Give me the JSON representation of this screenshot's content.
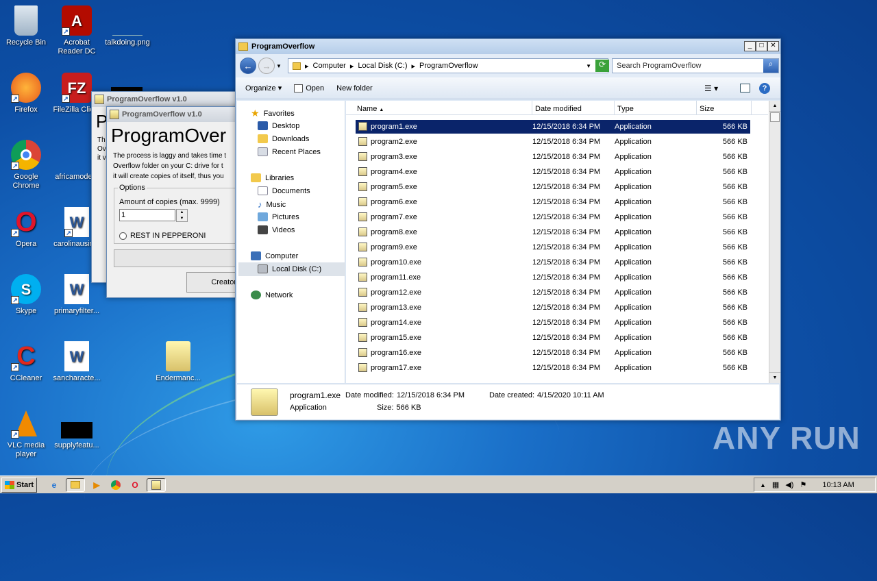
{
  "desktop": {
    "icons": [
      {
        "label": "Recycle Bin",
        "icon": "recycle-bin-icon"
      },
      {
        "label": "Acrobat Reader DC",
        "icon": "acrobat-icon"
      },
      {
        "label": "talkdoing.png",
        "icon": "image-file-icon"
      },
      {
        "label": "Firefox",
        "icon": "firefox-icon"
      },
      {
        "label": "FileZilla Clie...",
        "icon": "filezilla-icon"
      },
      {
        "label": "Google Chrome",
        "icon": "chrome-icon"
      },
      {
        "label": "africamode...",
        "icon": "file-icon"
      },
      {
        "label": "Opera",
        "icon": "opera-icon"
      },
      {
        "label": "carolinausin...",
        "icon": "word-doc-icon"
      },
      {
        "label": "Skype",
        "icon": "skype-icon"
      },
      {
        "label": "primaryfilter...",
        "icon": "word-doc-icon"
      },
      {
        "label": "CCleaner",
        "icon": "ccleaner-icon"
      },
      {
        "label": "sancharacte...",
        "icon": "word-doc-icon"
      },
      {
        "label": "Endermanc...",
        "icon": "program-icon"
      },
      {
        "label": "VLC media player",
        "icon": "vlc-icon"
      },
      {
        "label": "supplyfeatu...",
        "icon": "image-file-icon"
      }
    ]
  },
  "po_window": {
    "title": "ProgramOverflow v1.0",
    "heading": "ProgramOver",
    "description_lines": [
      "The process is laggy and takes time t",
      "Overflow folder on your C: drive for t",
      "it will create copies of itself, thus you"
    ],
    "options_label": "Options",
    "copies_label": "Amount of copies (max. 9999)",
    "copies_value": "1",
    "radio_label": "REST IN PEPPERONI",
    "creator_button": "Creator",
    "back_heading": "P",
    "back_text": [
      "Th",
      "Ov",
      "it v"
    ]
  },
  "explorer": {
    "title": "ProgramOverflow",
    "breadcrumb": [
      "Computer",
      "Local Disk (C:)",
      "ProgramOverflow"
    ],
    "search_placeholder": "Search ProgramOverflow",
    "commands": {
      "organize": "Organize",
      "open": "Open",
      "new_folder": "New folder"
    },
    "nav": {
      "favorites": "Favorites",
      "desktop": "Desktop",
      "downloads": "Downloads",
      "recent": "Recent Places",
      "libraries": "Libraries",
      "documents": "Documents",
      "music": "Music",
      "pictures": "Pictures",
      "videos": "Videos",
      "computer": "Computer",
      "local_disk": "Local Disk (C:)",
      "network": "Network"
    },
    "columns": {
      "name": "Name",
      "date": "Date modified",
      "type": "Type",
      "size": "Size"
    },
    "files": [
      {
        "name": "program1.exe",
        "date": "12/15/2018 6:34 PM",
        "type": "Application",
        "size": "566 KB"
      },
      {
        "name": "program2.exe",
        "date": "12/15/2018 6:34 PM",
        "type": "Application",
        "size": "566 KB"
      },
      {
        "name": "program3.exe",
        "date": "12/15/2018 6:34 PM",
        "type": "Application",
        "size": "566 KB"
      },
      {
        "name": "program4.exe",
        "date": "12/15/2018 6:34 PM",
        "type": "Application",
        "size": "566 KB"
      },
      {
        "name": "program5.exe",
        "date": "12/15/2018 6:34 PM",
        "type": "Application",
        "size": "566 KB"
      },
      {
        "name": "program6.exe",
        "date": "12/15/2018 6:34 PM",
        "type": "Application",
        "size": "566 KB"
      },
      {
        "name": "program7.exe",
        "date": "12/15/2018 6:34 PM",
        "type": "Application",
        "size": "566 KB"
      },
      {
        "name": "program8.exe",
        "date": "12/15/2018 6:34 PM",
        "type": "Application",
        "size": "566 KB"
      },
      {
        "name": "program9.exe",
        "date": "12/15/2018 6:34 PM",
        "type": "Application",
        "size": "566 KB"
      },
      {
        "name": "program10.exe",
        "date": "12/15/2018 6:34 PM",
        "type": "Application",
        "size": "566 KB"
      },
      {
        "name": "program11.exe",
        "date": "12/15/2018 6:34 PM",
        "type": "Application",
        "size": "566 KB"
      },
      {
        "name": "program12.exe",
        "date": "12/15/2018 6:34 PM",
        "type": "Application",
        "size": "566 KB"
      },
      {
        "name": "program13.exe",
        "date": "12/15/2018 6:34 PM",
        "type": "Application",
        "size": "566 KB"
      },
      {
        "name": "program14.exe",
        "date": "12/15/2018 6:34 PM",
        "type": "Application",
        "size": "566 KB"
      },
      {
        "name": "program15.exe",
        "date": "12/15/2018 6:34 PM",
        "type": "Application",
        "size": "566 KB"
      },
      {
        "name": "program16.exe",
        "date": "12/15/2018 6:34 PM",
        "type": "Application",
        "size": "566 KB"
      },
      {
        "name": "program17.exe",
        "date": "12/15/2018 6:34 PM",
        "type": "Application",
        "size": "566 KB"
      }
    ],
    "details": {
      "name": "program1.exe",
      "modified_label": "Date modified:",
      "modified": "12/15/2018 6:34 PM",
      "created_label": "Date created:",
      "created": "4/15/2020 10:11 AM",
      "type": "Application",
      "size_label": "Size:",
      "size": "566 KB"
    }
  },
  "taskbar": {
    "start": "Start",
    "clock": "10:13 AM"
  },
  "watermark": "ANY RUN"
}
